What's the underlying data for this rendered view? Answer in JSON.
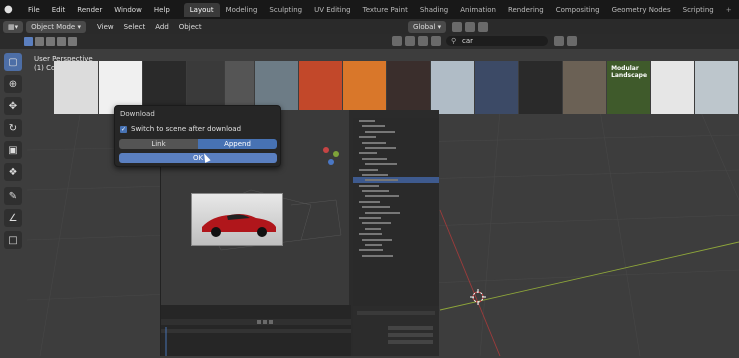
{
  "menu": [
    "File",
    "Edit",
    "Render",
    "Window",
    "Help"
  ],
  "workspaces": [
    "Layout",
    "Modeling",
    "Sculpting",
    "UV Editing",
    "Texture Paint",
    "Shading",
    "Animation",
    "Rendering",
    "Compositing",
    "Geometry Nodes",
    "Scripting"
  ],
  "active_workspace": "Layout",
  "header": {
    "mode": "Object Mode",
    "items": [
      "View",
      "Select",
      "Add",
      "Object"
    ],
    "orientation": "Global"
  },
  "search": {
    "value": "car"
  },
  "viewport": {
    "perspective": "User Perspective",
    "collection": "(1) Collection"
  },
  "thumbnails": [
    {
      "color": "#dcdcdc"
    },
    {
      "color": "#f0f0f0"
    },
    {
      "color": "#2a2a2a"
    },
    {
      "color": "#3a3a3a"
    },
    {
      "color": "#555"
    },
    {
      "color": "#6d7c86"
    },
    {
      "color": "#c2482a"
    },
    {
      "color": "#d9772a"
    },
    {
      "color": "#3a2e2c"
    },
    {
      "color": "#b0bcc6"
    },
    {
      "color": "#3c4a66"
    },
    {
      "color": "#2a2a2a"
    },
    {
      "color": "#6b6155"
    },
    {
      "color": "#3f5a2b",
      "label": "Modular Landscape"
    },
    {
      "color": "#e6e6e6"
    },
    {
      "color": "#bdc6cc"
    }
  ],
  "dialog": {
    "title": "Download",
    "checkbox_label": "Switch to scene after download",
    "link_label": "Link",
    "append_label": "Append",
    "ok_label": "OK"
  },
  "colors": {
    "accent": "#4772b3",
    "selected": "#3e5a8e"
  }
}
